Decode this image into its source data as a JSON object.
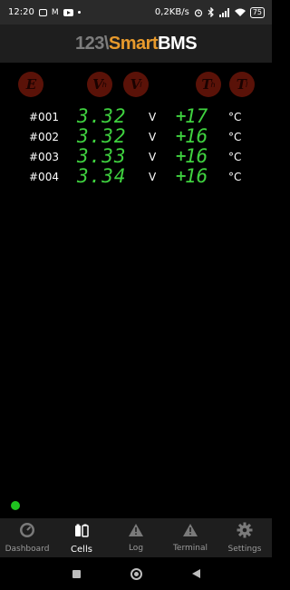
{
  "status": {
    "time": "12:20",
    "speed": "0,2KB/s",
    "battery": "75"
  },
  "header": {
    "logo_part1": "123\\",
    "logo_part2": "Smart",
    "logo_part3": "BMS"
  },
  "columns": {
    "e": "E",
    "vh_main": "V",
    "vh_sub": "h",
    "vl_main": "V",
    "vl_sub": "l",
    "th_main": "T",
    "th_sub": "h",
    "tl_main": "T",
    "tl_sub": "l"
  },
  "cells": [
    {
      "id": "#001",
      "voltage": "3.32",
      "vunit": "V",
      "sign": "+",
      "temp": "17",
      "tunit": "°C"
    },
    {
      "id": "#002",
      "voltage": "3.32",
      "vunit": "V",
      "sign": "+",
      "temp": "16",
      "tunit": "°C"
    },
    {
      "id": "#003",
      "voltage": "3.33",
      "vunit": "V",
      "sign": "+",
      "temp": "16",
      "tunit": "°C"
    },
    {
      "id": "#004",
      "voltage": "3.34",
      "vunit": "V",
      "sign": "+",
      "temp": "16",
      "tunit": "°C"
    }
  ],
  "nav": [
    {
      "label": "Dashboard",
      "icon": "gauge-icon"
    },
    {
      "label": "Cells",
      "icon": "battery-cells-icon"
    },
    {
      "label": "Log",
      "icon": "warning-icon"
    },
    {
      "label": "Terminal",
      "icon": "warning-icon"
    },
    {
      "label": "Settings",
      "icon": "gear-icon"
    }
  ],
  "colors": {
    "accent_green": "#3fd13f",
    "logo_orange": "#e89a2c",
    "icon_bg": "#5a1208",
    "connection_dot": "#1fc21f"
  }
}
